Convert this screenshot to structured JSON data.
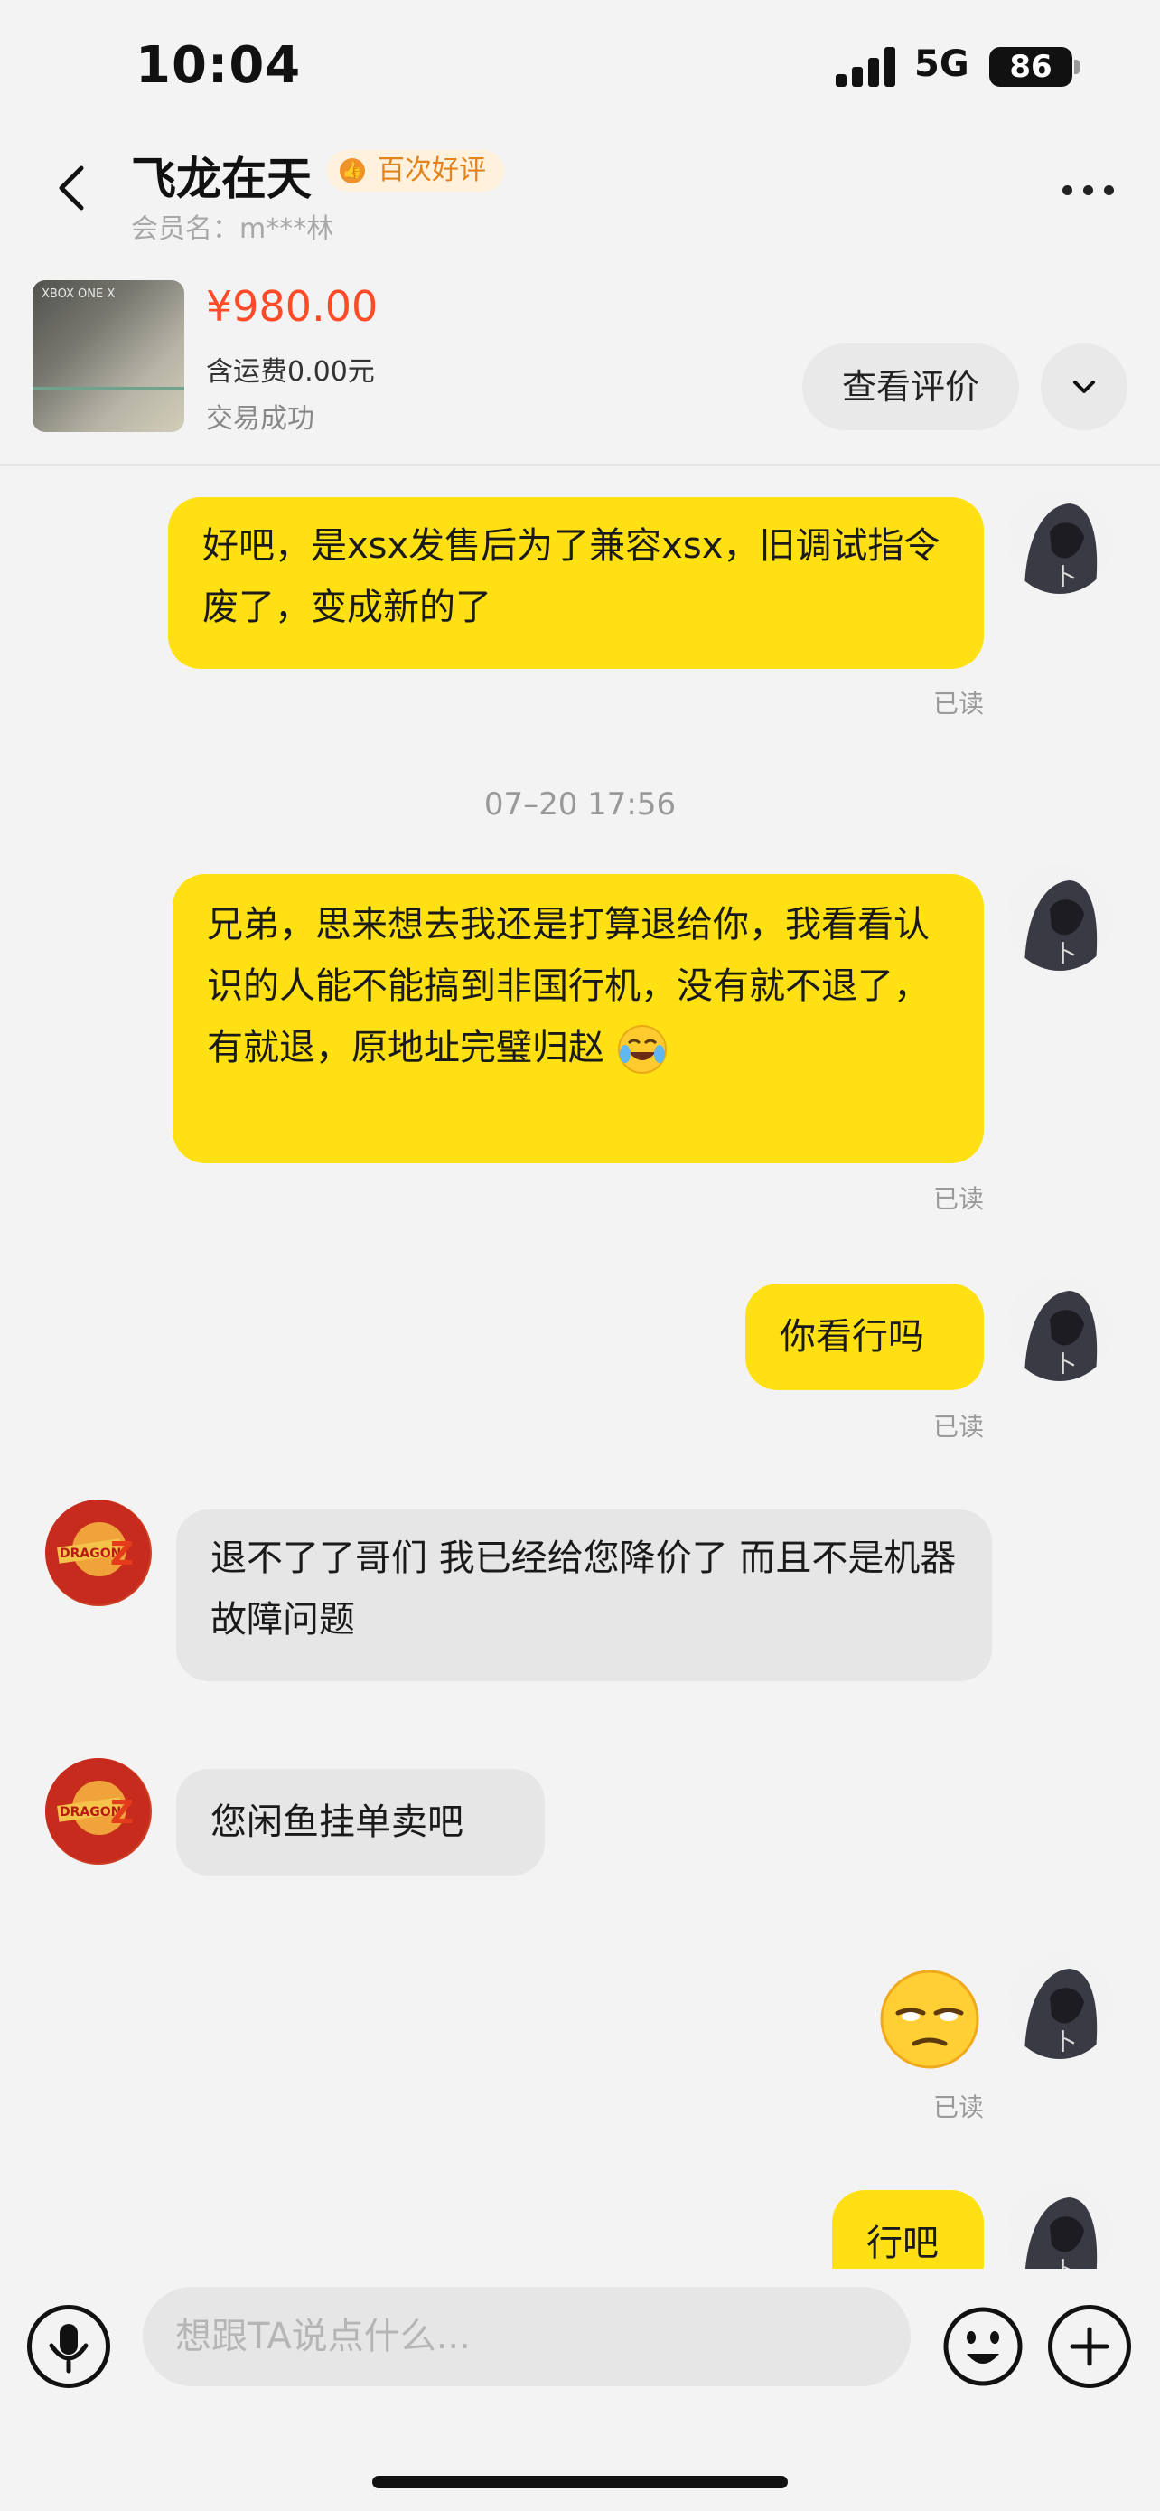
{
  "status_bar": {
    "time": "10:04",
    "network": "5G",
    "battery": "86"
  },
  "header": {
    "name": "飞龙在天",
    "badge": "百次好评",
    "member": "会员名：m***林"
  },
  "product": {
    "price": "¥980.00",
    "shipping": "含运费0.00元",
    "status": "交易成功",
    "review_button": "查看评价",
    "thumb_mark": "XBOX ONE X"
  },
  "messages": [
    {
      "from": "me",
      "text": "好吧，是xsx发售后为了兼容xsx，旧调试指令废了，变成新的了",
      "read": "已读"
    },
    {
      "type": "time",
      "text": "07–20 17:56"
    },
    {
      "from": "me",
      "text": "兄弟，思来想去我还是打算退给你，我看看认识的人能不能搞到非国行机，没有就不退了，有就退，原地址完璧归赵",
      "emoji": "crying-laughing",
      "read": "已读"
    },
    {
      "from": "me",
      "text": "你看行吗",
      "read": "已读"
    },
    {
      "from": "other",
      "text": "退不了了哥们 我已经给您降价了 而且不是机器故障问题"
    },
    {
      "from": "other",
      "text": "您闲鱼挂单卖吧"
    },
    {
      "from": "me",
      "sticker": "unamused-face",
      "read": "已读"
    },
    {
      "from": "me",
      "text": "行吧"
    }
  ],
  "input": {
    "placeholder": "想跟TA说点什么..."
  },
  "icons": {
    "back": "back-arrow-icon",
    "more": "more-dots-icon",
    "expand": "chevron-down-icon",
    "mic": "microphone-icon",
    "emoji": "emoji-icon",
    "plus": "plus-icon"
  },
  "colors": {
    "my_bubble": "#ffe113",
    "other_bubble": "#e6e6e6",
    "price": "#ff4b27",
    "badge_text": "#e2831d"
  }
}
